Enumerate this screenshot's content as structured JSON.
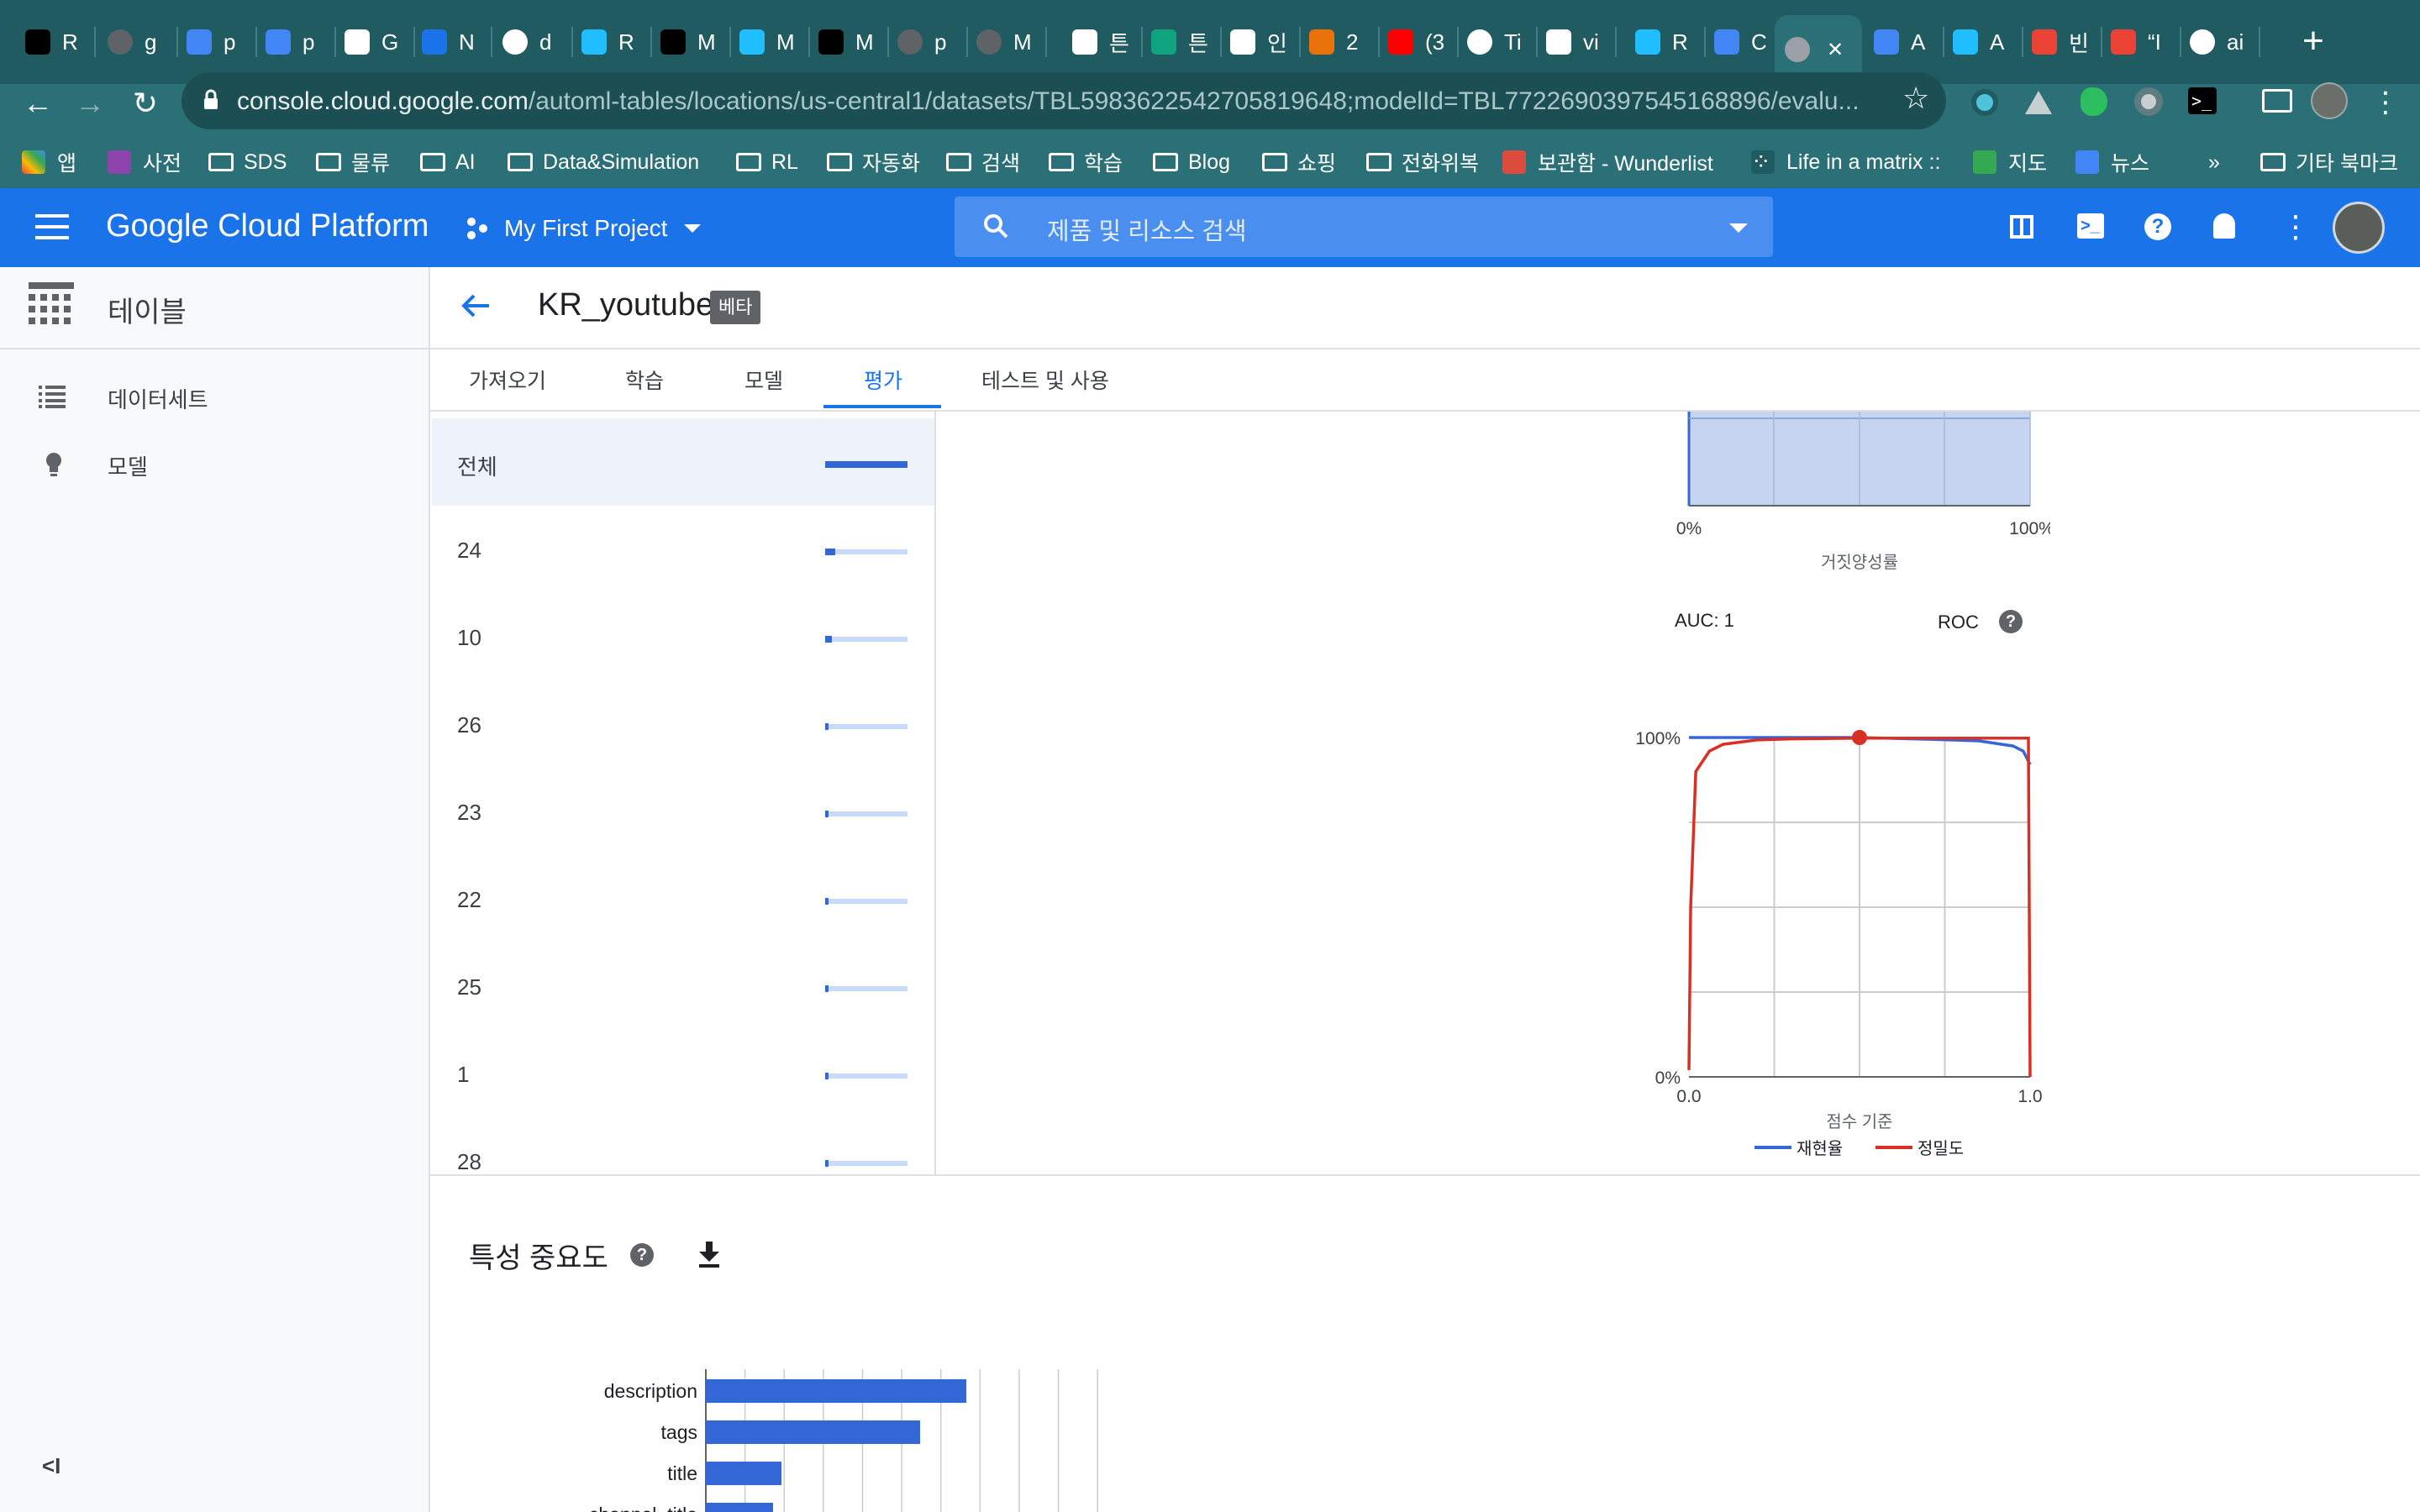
{
  "browser": {
    "tabs": [
      {
        "label": "R",
        "icon": "generic-favicon",
        "color": "#000000"
      },
      {
        "label": "g",
        "icon": "globe-favicon",
        "color": "#5f6368"
      },
      {
        "label": "p",
        "icon": "chat-favicon",
        "color": "#4285f4"
      },
      {
        "label": "p",
        "icon": "chat-favicon",
        "color": "#4285f4"
      },
      {
        "label": "G",
        "icon": "infinity-favicon",
        "color": "#ffffff"
      },
      {
        "label": "N",
        "icon": "mountain-favicon",
        "color": "#1a73e8"
      },
      {
        "label": "d",
        "icon": "github-favicon",
        "color": "#ffffff"
      },
      {
        "label": "R",
        "icon": "k-favicon",
        "color": "#20beff"
      },
      {
        "label": "M",
        "icon": "medium-favicon",
        "color": "#000000"
      },
      {
        "label": "M",
        "icon": "k-favicon",
        "color": "#20beff"
      },
      {
        "label": "M",
        "icon": "medium-favicon",
        "color": "#000000"
      },
      {
        "label": "p",
        "icon": "globe-favicon",
        "color": "#5f6368"
      },
      {
        "label": "M",
        "icon": "globe-favicon",
        "color": "#5f6368"
      },
      {
        "label": "튼",
        "icon": "wikipedia-favicon",
        "color": "#ffffff"
      },
      {
        "label": "튼",
        "icon": "green-favicon",
        "color": "#10a37f"
      },
      {
        "label": "인",
        "icon": "wikipedia-favicon",
        "color": "#ffffff"
      },
      {
        "label": "2",
        "icon": "gear-favicon",
        "color": "#e8710a"
      },
      {
        "label": "(3",
        "icon": "youtube-favicon",
        "color": "#ff0000"
      },
      {
        "label": "Ti",
        "icon": "github-favicon",
        "color": "#ffffff"
      },
      {
        "label": "vi",
        "icon": "google-favicon",
        "color": "#ffffff"
      },
      {
        "label": "R",
        "icon": "k-favicon",
        "color": "#20beff"
      },
      {
        "label": "C",
        "icon": "cloud-favicon",
        "color": "#4285f4"
      },
      {
        "label": "",
        "icon": "hex-favicon",
        "color": "#9aa0a6",
        "active": true
      },
      {
        "label": "A",
        "icon": "cloud-favicon",
        "color": "#4285f4"
      },
      {
        "label": "A",
        "icon": "k-favicon",
        "color": "#20beff"
      },
      {
        "label": "빈",
        "icon": "gmail-favicon",
        "color": "#ea4335"
      },
      {
        "label": "“I",
        "icon": "it-favicon",
        "color": "#ea4335"
      },
      {
        "label": "ai",
        "icon": "github-favicon",
        "color": "#ffffff"
      }
    ],
    "url_host": "console.cloud.google.com",
    "url_path": "/automl-tables/locations/us-central1/datasets/TBL5983622542705819648;modelId=TBL7722690397545168896/evalu...",
    "bookmarks": [
      {
        "label": "앱",
        "icon": "apps-icon"
      },
      {
        "label": "사전",
        "icon": "d-icon"
      },
      {
        "label": "SDS",
        "icon": "folder-icon"
      },
      {
        "label": "물류",
        "icon": "folder-icon"
      },
      {
        "label": "AI",
        "icon": "folder-icon"
      },
      {
        "label": "Data&Simulation",
        "icon": "folder-icon"
      },
      {
        "label": "RL",
        "icon": "folder-icon"
      },
      {
        "label": "자동화",
        "icon": "folder-icon"
      },
      {
        "label": "검색",
        "icon": "folder-icon"
      },
      {
        "label": "학습",
        "icon": "folder-icon"
      },
      {
        "label": "Blog",
        "icon": "folder-icon"
      },
      {
        "label": "쇼핑",
        "icon": "folder-icon"
      },
      {
        "label": "전화위복",
        "icon": "folder-icon"
      },
      {
        "label": "보관함 - Wunderlist",
        "icon": "star-icon"
      },
      {
        "label": "Life in a matrix ::",
        "icon": "dots-icon"
      },
      {
        "label": "지도",
        "icon": "maps-icon"
      },
      {
        "label": "뉴스",
        "icon": "news-icon"
      }
    ],
    "bookmarks_more": "»",
    "other_bookmarks": "기타 북마크"
  },
  "gcp": {
    "brand": "Google Cloud Platform",
    "project": "My First Project",
    "search_placeholder": "제품 및 리소스 검색",
    "accent": "#1a73e8"
  },
  "sidebar": {
    "title": "테이블",
    "items": [
      {
        "label": "데이터세트",
        "icon": "list-icon"
      },
      {
        "label": "모델",
        "icon": "bulb-icon"
      }
    ],
    "collapse": "<I"
  },
  "page": {
    "title": "KR_youtube",
    "badge": "베타",
    "tabs": [
      "가져오기",
      "학습",
      "모델",
      "평가",
      "테스트 및 사용"
    ],
    "active_tab": "평가"
  },
  "label_list": [
    {
      "label": "전체",
      "fraction": 1.0
    },
    {
      "label": "24",
      "fraction": 0.12
    },
    {
      "label": "10",
      "fraction": 0.08
    },
    {
      "label": "26",
      "fraction": 0.04
    },
    {
      "label": "23",
      "fraction": 0.04
    },
    {
      "label": "22",
      "fraction": 0.03
    },
    {
      "label": "25",
      "fraction": 0.03
    },
    {
      "label": "1",
      "fraction": 0.03
    },
    {
      "label": "28",
      "fraction": 0.03
    }
  ],
  "roc_partial": {
    "x_ticks": [
      "0%",
      "100%"
    ],
    "xlabel": "거짓양성률"
  },
  "metrics": {
    "auc": "AUC: 1",
    "roc": "ROC"
  },
  "feature_importance": {
    "title": "특성 중요도"
  },
  "chart_data": [
    {
      "type": "line",
      "title": "",
      "xlabel": "점수 기준",
      "ylabel": "",
      "xlim": [
        0.0,
        1.0
      ],
      "ylim": [
        0,
        100
      ],
      "x_tick_labels": [
        "0.0",
        "1.0"
      ],
      "y_tick_labels": [
        "0%",
        "100%"
      ],
      "grid": true,
      "legend": "bottom",
      "series": [
        {
          "name": "재현율",
          "color": "#3367d6",
          "x": [
            0.0,
            0.01,
            0.05,
            0.1,
            0.3,
            0.5,
            0.7,
            0.85,
            0.95,
            0.98,
            1.0
          ],
          "y": [
            100,
            100,
            100,
            100,
            100,
            100,
            99.5,
            99,
            97.5,
            96,
            92
          ]
        },
        {
          "name": "정밀도",
          "color": "#d93025",
          "x": [
            0.0,
            0.005,
            0.02,
            0.06,
            0.1,
            0.2,
            0.3,
            0.5,
            0.7,
            0.9,
            0.99,
            0.995,
            1.0
          ],
          "y": [
            2,
            50,
            90,
            96,
            98,
            99.3,
            99.6,
            99.8,
            99.8,
            99.8,
            99.8,
            99.8,
            0
          ]
        }
      ],
      "marker": {
        "x": 0.5,
        "y": 100,
        "color": "#d93025"
      }
    },
    {
      "type": "bar",
      "orientation": "horizontal",
      "title": "특성 중요도",
      "categories": [
        "description",
        "tags",
        "title",
        "channel_title"
      ],
      "values": [
        31,
        25.5,
        9,
        8
      ],
      "xlim": [
        0,
        84
      ],
      "grid": true,
      "color": "#3367d6"
    }
  ]
}
